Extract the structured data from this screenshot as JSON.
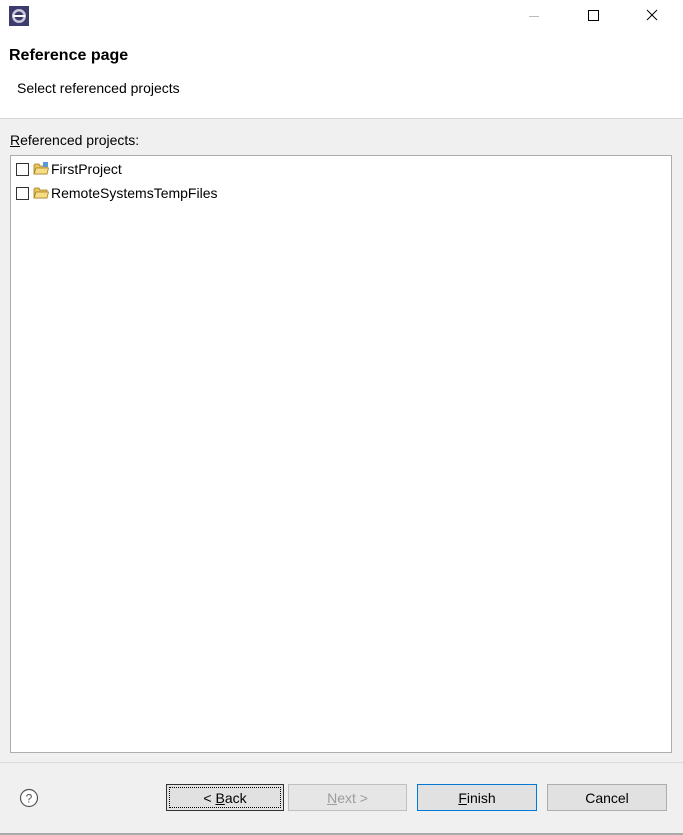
{
  "window": {
    "app_icon": "eclipse-icon",
    "controls": [
      "minimize-icon",
      "maximize-icon",
      "close-icon"
    ]
  },
  "header": {
    "title": "Reference page",
    "description": "Select referenced projects"
  },
  "content": {
    "list_label_accel": "R",
    "list_label_rest": "eferenced projects:",
    "projects": [
      {
        "name": "FirstProject",
        "checked": false,
        "icon": "project-folder-icon"
      },
      {
        "name": "RemoteSystemsTempFiles",
        "checked": false,
        "icon": "project-folder-icon"
      }
    ]
  },
  "footer": {
    "help_icon": "help-icon",
    "back": {
      "prefix": "< ",
      "accel": "B",
      "rest": "ack"
    },
    "next": {
      "accel": "N",
      "rest": "ext >"
    },
    "finish": {
      "accel": "F",
      "rest": "inish"
    },
    "cancel": "Cancel"
  },
  "colors": {
    "focus_border": "#0078d7",
    "red_marker": "#e81123"
  }
}
